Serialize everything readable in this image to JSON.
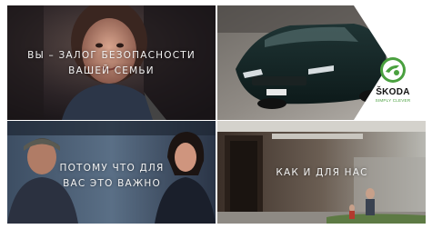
{
  "brand": {
    "wordmark": "ŠKODA",
    "tagline": "SIMPLY CLEVER",
    "accent_color": "#4aa03f"
  },
  "tiles": [
    {
      "caption_line1": "ВЫ – ЗАЛОГ БЕЗОПАСНОСТИ",
      "caption_line2": "ВАШЕЙ СЕМЬИ"
    },
    {
      "caption_line1": "",
      "caption_line2": ""
    },
    {
      "caption_line1": "ПОТОМУ ЧТО ДЛЯ",
      "caption_line2": "ВАС ЭТО ВАЖНО"
    },
    {
      "caption_line1": "КАК И ДЛЯ НАС",
      "caption_line2": ""
    }
  ]
}
